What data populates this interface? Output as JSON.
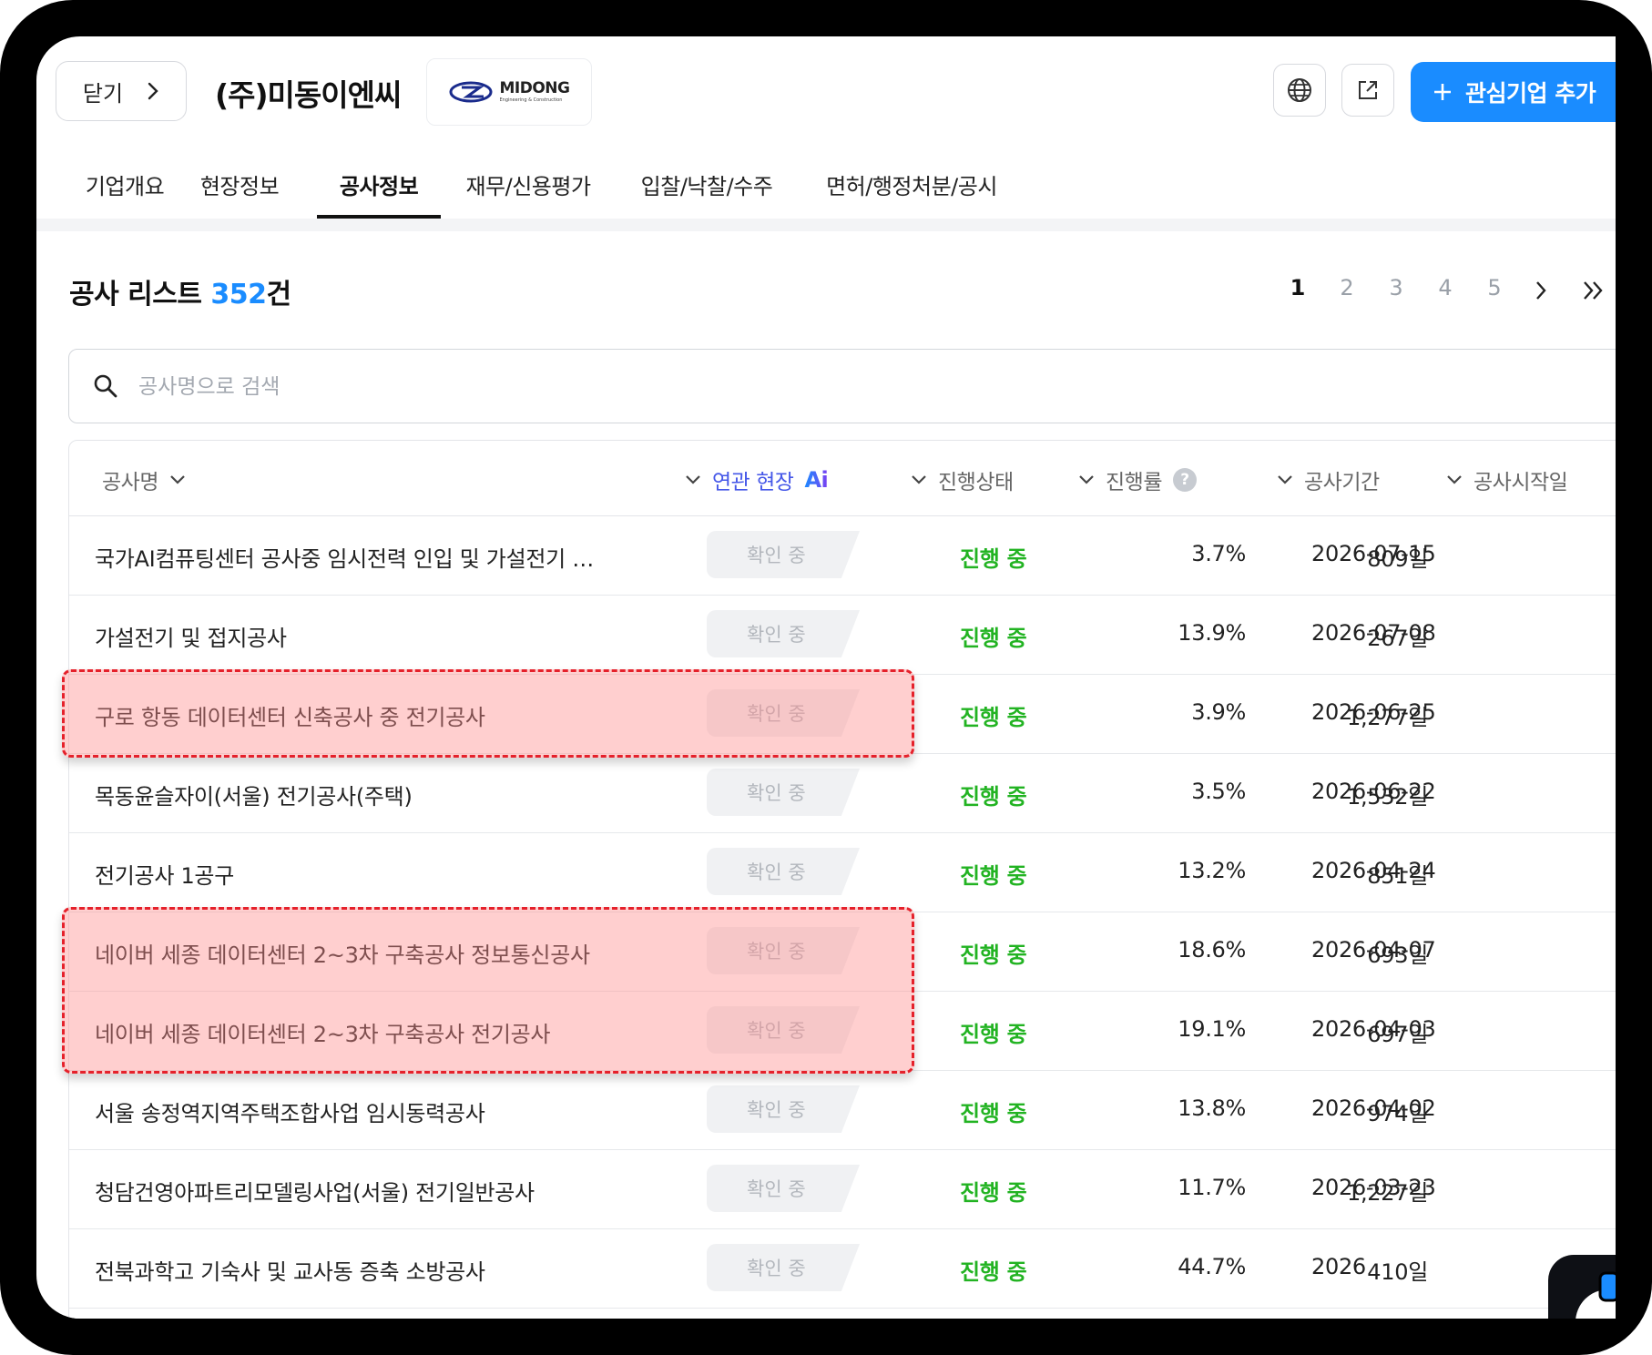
{
  "header": {
    "close_label": "닫기",
    "company_name": "(주)미동이엔씨",
    "logo_text": "MIDONG",
    "logo_subtext": "Engineering & Construction",
    "add_interest_label": "관심기업 추가"
  },
  "tabs": [
    {
      "label": "기업개요",
      "active": false
    },
    {
      "label": "현장정보",
      "active": false
    },
    {
      "label": "공사정보",
      "active": true
    },
    {
      "label": "재무/신용평가",
      "active": false
    },
    {
      "label": "입찰/낙찰/수주",
      "active": false
    },
    {
      "label": "면허/행정처분/공시",
      "active": false
    }
  ],
  "list": {
    "title": "공사 리스트",
    "count": "352",
    "count_suffix": "건"
  },
  "pagination": {
    "pages": [
      "1",
      "2",
      "3",
      "4",
      "5"
    ],
    "active_page": "1"
  },
  "search": {
    "placeholder": "공사명으로 검색",
    "value": ""
  },
  "table": {
    "columns": {
      "name": "공사명",
      "related": "연관 현장",
      "ai": "Ai",
      "status": "진행상태",
      "rate": "진행률",
      "period": "공사기간",
      "start": "공사시작일"
    },
    "rows": [
      {
        "name": "국가AI컴퓨팅센터 공사중 임시전력 인입 및 가설전기 …",
        "related": "확인 중",
        "status": "진행 중",
        "rate": "3.7%",
        "period": "809일",
        "start": "2026-07-15"
      },
      {
        "name": "가설전기 및 접지공사",
        "related": "확인 중",
        "status": "진행 중",
        "rate": "13.9%",
        "period": "267일",
        "start": "2026-07-08"
      },
      {
        "name": "구로 항동 데이터센터 신축공사 중 전기공사",
        "related": "확인 중",
        "status": "진행 중",
        "rate": "3.9%",
        "period": "1,277일",
        "start": "2026-06-25"
      },
      {
        "name": "목동윤슬자이(서울) 전기공사(주택)",
        "related": "확인 중",
        "status": "진행 중",
        "rate": "3.5%",
        "period": "1,532일",
        "start": "2026-06-22"
      },
      {
        "name": "전기공사 1공구",
        "related": "확인 중",
        "status": "진행 중",
        "rate": "13.2%",
        "period": "851일",
        "start": "2026-04-24"
      },
      {
        "name": "네이버 세종 데이터센터 2~3차 구축공사 정보통신공사",
        "related": "확인 중",
        "status": "진행 중",
        "rate": "18.6%",
        "period": "693일",
        "start": "2026-04-07"
      },
      {
        "name": "네이버 세종 데이터센터 2~3차 구축공사 전기공사",
        "related": "확인 중",
        "status": "진행 중",
        "rate": "19.1%",
        "period": "697일",
        "start": "2026-04-03"
      },
      {
        "name": "서울 송정역지역주택조합사업 임시동력공사",
        "related": "확인 중",
        "status": "진행 중",
        "rate": "13.8%",
        "period": "974일",
        "start": "2026-04-02"
      },
      {
        "name": "청담건영아파트리모델링사업(서울) 전기일반공사",
        "related": "확인 중",
        "status": "진행 중",
        "rate": "11.7%",
        "period": "1,227일",
        "start": "2026-03-23"
      },
      {
        "name": "전북과학고 기숙사 및 교사동 증축 소방공사",
        "related": "확인 중",
        "status": "진행 중",
        "rate": "44.7%",
        "period": "410일",
        "start": "2026"
      }
    ]
  },
  "colors": {
    "accent": "#1a8cff",
    "status_green": "#22b322",
    "highlight_border": "#e5212b"
  }
}
